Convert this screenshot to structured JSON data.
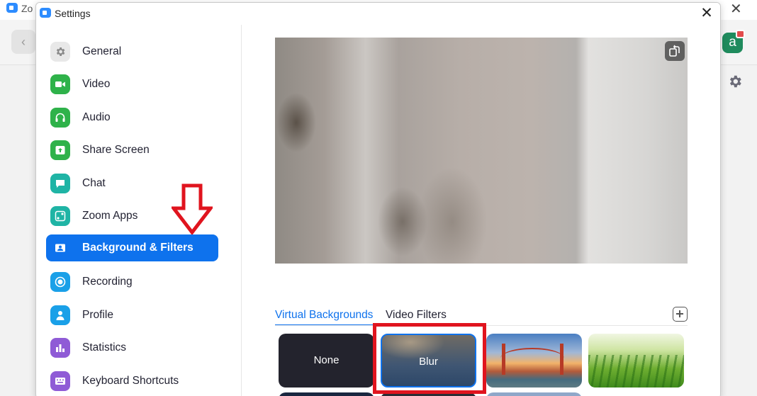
{
  "background_window": {
    "title": "Zo",
    "avatar_letter": "a",
    "icons": [
      "zoom-app-icon",
      "back-chevron-icon",
      "close-icon",
      "settings-gear-icon"
    ]
  },
  "dialog": {
    "title": "Settings",
    "close_glyph": "✕"
  },
  "sidebar": {
    "items": [
      {
        "label": "General",
        "icon": "gear-icon",
        "color": "#e8e8e8"
      },
      {
        "label": "Video",
        "icon": "video-camera-icon",
        "color": "#2fb24a"
      },
      {
        "label": "Audio",
        "icon": "headphones-icon",
        "color": "#2fb24a"
      },
      {
        "label": "Share Screen",
        "icon": "share-screen-icon",
        "color": "#2fb24a"
      },
      {
        "label": "Chat",
        "icon": "chat-bubble-icon",
        "color": "#1fb4a5"
      },
      {
        "label": "Zoom Apps",
        "icon": "zoom-apps-icon",
        "color": "#1fb4a5"
      },
      {
        "label": "Background & Filters",
        "icon": "background-icon",
        "color": "#0e72ed",
        "active": true
      },
      {
        "label": "Recording",
        "icon": "record-icon",
        "color": "#1aa0e8"
      },
      {
        "label": "Profile",
        "icon": "person-icon",
        "color": "#1aa0e8"
      },
      {
        "label": "Statistics",
        "icon": "bar-chart-icon",
        "color": "#8f5bd6"
      },
      {
        "label": "Keyboard Shortcuts",
        "icon": "keyboard-icon",
        "color": "#8f5bd6"
      }
    ]
  },
  "annotations": {
    "arrow_color": "#e0141e",
    "highlight_color": "#e0141e"
  },
  "main": {
    "tabs": [
      {
        "label": "Virtual Backgrounds",
        "active": true
      },
      {
        "label": "Video Filters",
        "active": false
      }
    ],
    "backgrounds": [
      {
        "label": "None",
        "name": "background-none"
      },
      {
        "label": "Blur",
        "name": "background-blur",
        "selected": true
      },
      {
        "label": "",
        "name": "background-golden-gate"
      },
      {
        "label": "",
        "name": "background-grass"
      }
    ]
  },
  "colors": {
    "accent": "#0e72ed",
    "text": "#232333"
  }
}
